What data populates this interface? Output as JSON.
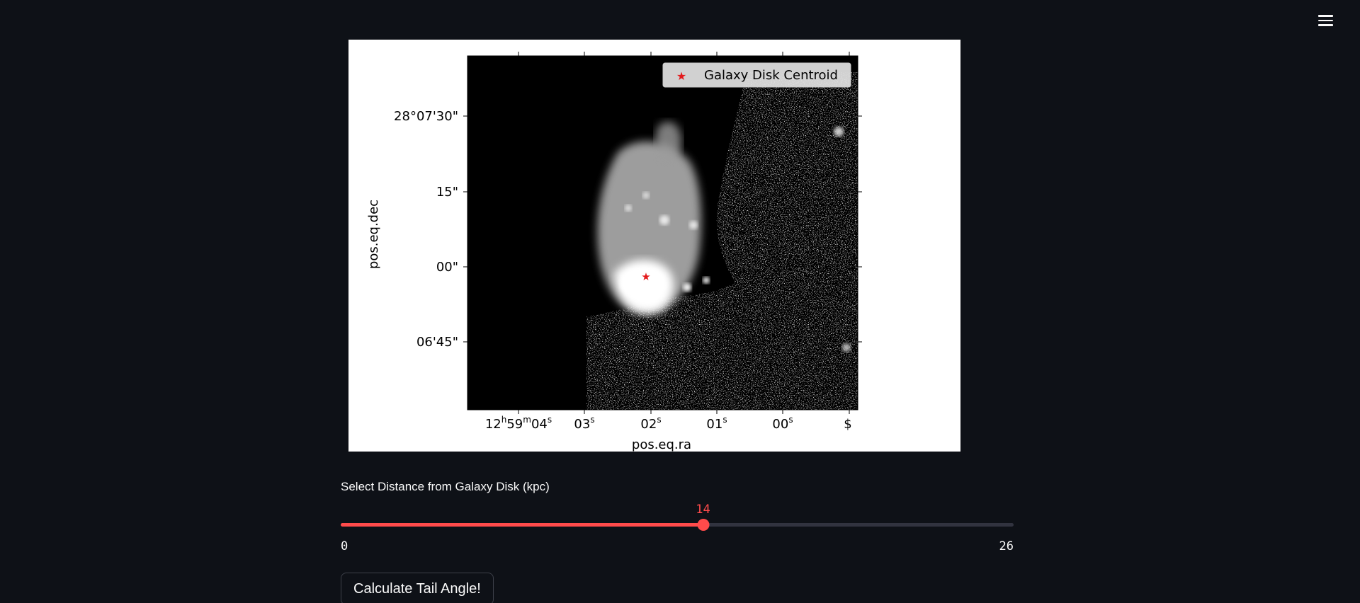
{
  "menu": {
    "icon": "hamburger-menu-icon"
  },
  "figure": {
    "legend_label": "Galaxy Disk Centroid",
    "legend_marker_color": "#e31a1c",
    "xlabel": "pos.eq.ra",
    "ylabel": "pos.eq.dec",
    "x_ticks": [
      {
        "h": "12",
        "m": "59",
        "s": "04"
      },
      {
        "s": "03"
      },
      {
        "s": "02"
      },
      {
        "s": "01"
      },
      {
        "s": "00"
      },
      {
        "text": "$"
      }
    ],
    "y_ticks": [
      "28°07'30\"",
      "15\"",
      "00\"",
      "06'45\""
    ]
  },
  "slider": {
    "label": "Select Distance from Galaxy Disk (kpc)",
    "value": "14",
    "min": "0",
    "max": "26",
    "color": "#ff4b4b"
  },
  "button": {
    "label": "Calculate Tail Angle!"
  }
}
